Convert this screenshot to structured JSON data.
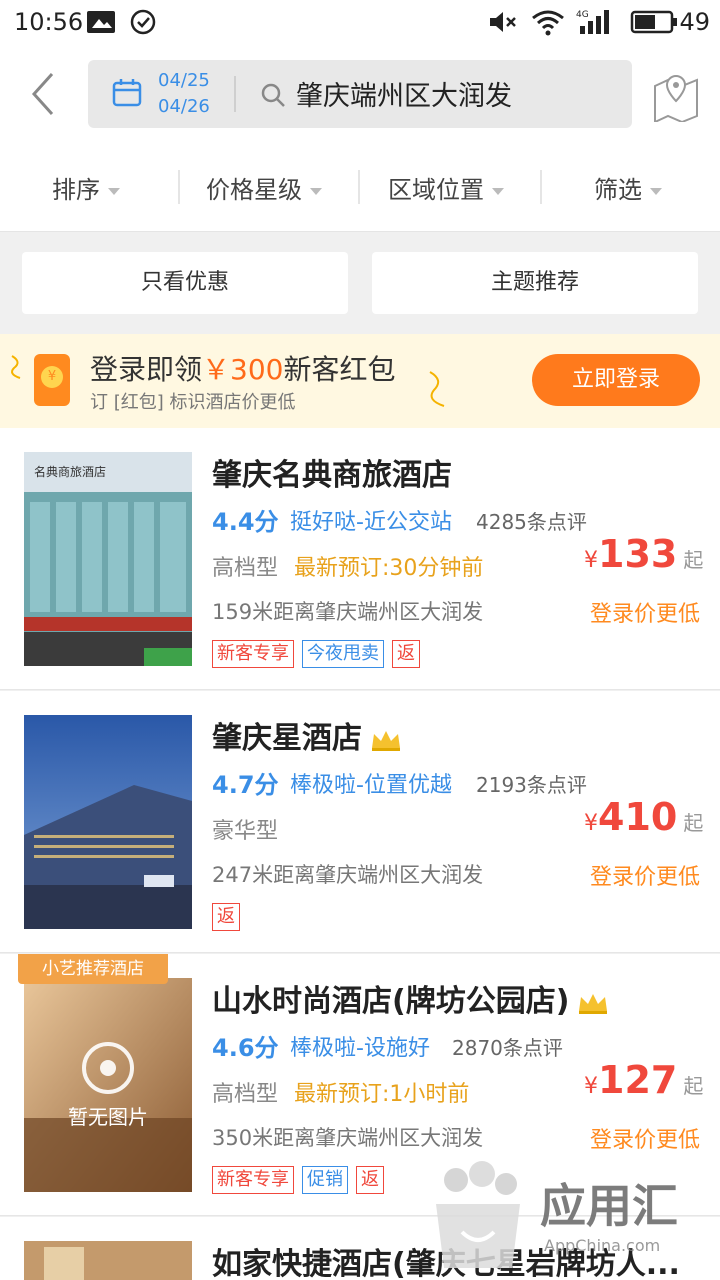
{
  "status_bar": {
    "time": "10:56",
    "battery": "49"
  },
  "header": {
    "check_in": "04/25",
    "check_out": "04/26",
    "query": "肇庆端州区大润发"
  },
  "filters": [
    "排序",
    "价格星级",
    "区域位置",
    "筛选"
  ],
  "toggles": {
    "left": "只看优惠",
    "right": "主题推荐"
  },
  "promo": {
    "title_prefix": "登录即领",
    "amount": "￥300",
    "title_suffix": "新客红包",
    "subtitle": "订 [红包] 标识酒店价更低",
    "button": "立即登录"
  },
  "hotels": [
    {
      "name": "肇庆名典商旅酒店",
      "score": "4.4分",
      "comment": "挺好哒-近公交站",
      "reviews": "4285条点评",
      "grade": "高档型",
      "recent": "最新预订:30分钟前",
      "currency": "¥",
      "price": "133",
      "price_suffix": "起",
      "distance": "159米距离肇庆端州区大润发",
      "login_price": "登录价更低",
      "tags": [
        {
          "text": "新客专享",
          "color": "red"
        },
        {
          "text": "今夜甩卖",
          "color": "blue"
        },
        {
          "text": "返",
          "color": "red"
        }
      ],
      "image_sign": "名典商旅酒店"
    },
    {
      "name": "肇庆星酒店",
      "crown": true,
      "score": "4.7分",
      "comment": "棒极啦-位置优越",
      "reviews": "2193条点评",
      "grade": "豪华型",
      "recent": "",
      "currency": "¥",
      "price": "410",
      "price_suffix": "起",
      "distance": "247米距离肇庆端州区大润发",
      "login_price": "登录价更低",
      "tags": [
        {
          "text": "返",
          "color": "red"
        }
      ]
    },
    {
      "name": "山水时尚酒店(牌坊公园店)",
      "crown": true,
      "badge": "小艺推荐酒店",
      "no_image": "暂无图片",
      "score": "4.6分",
      "comment": "棒极啦-设施好",
      "reviews": "2870条点评",
      "grade": "高档型",
      "recent": "最新预订:1小时前",
      "currency": "¥",
      "price": "127",
      "price_suffix": "起",
      "distance": "350米距离肇庆端州区大润发",
      "login_price": "登录价更低",
      "tags": [
        {
          "text": "新客专享",
          "color": "red"
        },
        {
          "text": "促销",
          "color": "blue"
        },
        {
          "text": "返",
          "color": "red"
        }
      ]
    },
    {
      "name": "如家快捷酒店(肇庆七星岩牌坊人..."
    }
  ],
  "watermark": {
    "text": "应用汇",
    "sub": "AppChina.com"
  }
}
